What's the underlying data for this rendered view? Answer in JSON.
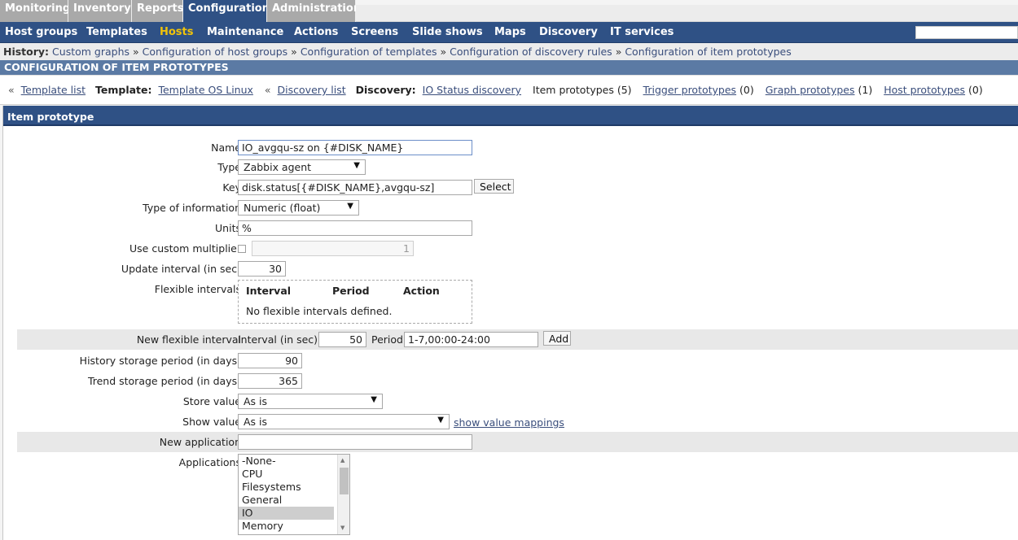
{
  "top_tabs": [
    {
      "label": "Monitoring"
    },
    {
      "label": "Inventory"
    },
    {
      "label": "Reports"
    },
    {
      "label": "Configuration"
    },
    {
      "label": "Administration"
    }
  ],
  "sub_menu": [
    {
      "label": "Host groups"
    },
    {
      "label": "Templates"
    },
    {
      "label": "Hosts"
    },
    {
      "label": "Maintenance"
    },
    {
      "label": "Actions"
    },
    {
      "label": "Screens"
    },
    {
      "label": "Slide shows"
    },
    {
      "label": "Maps"
    },
    {
      "label": "Discovery"
    },
    {
      "label": "IT services"
    }
  ],
  "search": {
    "value": ""
  },
  "history": {
    "label": "History:",
    "items": [
      "Custom graphs",
      "Configuration of host groups",
      "Configuration of templates",
      "Configuration of discovery rules",
      "Configuration of item prototypes"
    ],
    "separator": "»"
  },
  "page_title": "CONFIGURATION OF ITEM PROTOTYPES",
  "crumbs": {
    "back1": "«",
    "template_list": "Template list",
    "template_label": "Template:",
    "template_name": "Template OS Linux",
    "back2": "«",
    "discovery_list": "Discovery list",
    "discovery_label": "Discovery:",
    "discovery_name": "IO Status discovery",
    "item_prototypes": "Item prototypes (5)",
    "trigger_prototypes": "Trigger prototypes",
    "trigger_count": "(0)",
    "graph_prototypes": "Graph prototypes",
    "graph_count": "(1)",
    "host_prototypes": "Host prototypes",
    "host_count": "(0)"
  },
  "form": {
    "header": "Item prototype",
    "name_label": "Name",
    "name_value": "IO_avgqu-sz on {#DISK_NAME}",
    "type_label": "Type",
    "type_value": "Zabbix agent",
    "key_label": "Key",
    "key_value": "disk.status[{#DISK_NAME},avgqu-sz]",
    "select_button": "Select",
    "info_label": "Type of information",
    "info_value": "Numeric (float)",
    "units_label": "Units",
    "units_value": "%",
    "multiplier_label": "Use custom multiplier",
    "multiplier_value": "1",
    "update_label": "Update interval (in sec)",
    "update_value": "30",
    "flex_label": "Flexible intervals",
    "flex_headers": [
      "Interval",
      "Period",
      "Action"
    ],
    "flex_empty": "No flexible intervals defined.",
    "new_flex_label": "New flexible interval",
    "new_flex_interval_label": "Interval (in sec)",
    "new_flex_interval_value": "50",
    "new_flex_period_label": "Period",
    "new_flex_period_value": "1-7,00:00-24:00",
    "add_button": "Add",
    "history_label": "History storage period (in days)",
    "history_value": "90",
    "trend_label": "Trend storage period (in days)",
    "trend_value": "365",
    "store_label": "Store value",
    "store_value": "As is",
    "show_label": "Show value",
    "show_value": "As is",
    "show_mappings": "show value mappings",
    "new_app_label": "New application",
    "new_app_value": "",
    "apps_label": "Applications",
    "apps": [
      "-None-",
      "CPU",
      "Filesystems",
      "General",
      "IO",
      "Memory"
    ],
    "apps_selected": "IO"
  },
  "colors": {
    "nav_bg": "#2f5185",
    "active_sub": "#f0c30a",
    "link": "#3a4e7c",
    "title_bar": "#5b7aa4"
  }
}
